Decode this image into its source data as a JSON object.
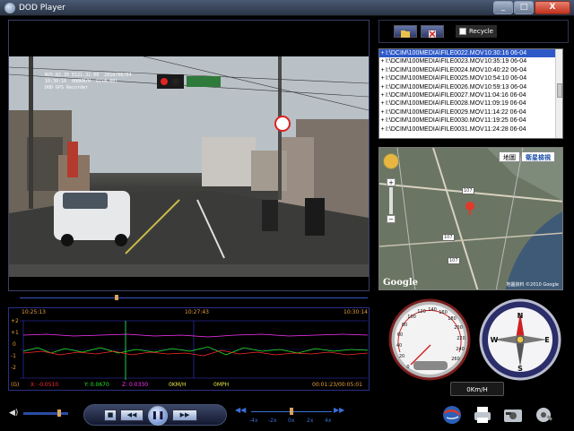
{
  "window": {
    "title": "DOD Player",
    "buttons": [
      "_",
      "□",
      "X"
    ]
  },
  "video": {
    "osd_lines": [
      "N25.02.35 E121.32.00  2010/06/04",
      "10:30:16  000KM/H  G(+0.00)",
      "DOD GPS Recorder"
    ]
  },
  "gsensor": {
    "time_start": "10:25:13",
    "time_mid": "10:27:43",
    "time_end": "10:30:14",
    "y_labels": [
      "+2",
      "+1",
      "0",
      "-1",
      "-2"
    ],
    "unit_label": "(G)",
    "x_value": "X: -0.0510",
    "y_value": "Y: 0.0670",
    "z_value": "Z: 0.0330",
    "kmh": "0KM/H",
    "mph": "0MPH",
    "elapsed": "00:01:23/00:05:01",
    "colors": {
      "x": "#ff2a2a",
      "y": "#22ee22",
      "z": "#ff33ff",
      "time": "#e6a23c"
    }
  },
  "playlist": {
    "recycle_label": "Recycle",
    "files": [
      {
        "name": "I:\\DCIM\\100MEDIA\\FILE0022.MOV",
        "time": "10:30:16 06-04",
        "selected": true
      },
      {
        "name": "I:\\DCIM\\100MEDIA\\FILE0023.MOV",
        "time": "10:35:19 06-04",
        "selected": false
      },
      {
        "name": "I:\\DCIM\\100MEDIA\\FILE0024.MOV",
        "time": "10:40:22 06-04",
        "selected": false
      },
      {
        "name": "I:\\DCIM\\100MEDIA\\FILE0025.MOV",
        "time": "10:54:10 06-04",
        "selected": false
      },
      {
        "name": "I:\\DCIM\\100MEDIA\\FILE0026.MOV",
        "time": "10:59:13 06-04",
        "selected": false
      },
      {
        "name": "I:\\DCIM\\100MEDIA\\FILE0027.MOV",
        "time": "11:04:16 06-04",
        "selected": false
      },
      {
        "name": "I:\\DCIM\\100MEDIA\\FILE0028.MOV",
        "time": "11:09:19 06-04",
        "selected": false
      },
      {
        "name": "I:\\DCIM\\100MEDIA\\FILE0029.MOV",
        "time": "11:14:22 06-04",
        "selected": false
      },
      {
        "name": "I:\\DCIM\\100MEDIA\\FILE0030.MOV",
        "time": "11:19:25 06-04",
        "selected": false
      },
      {
        "name": "I:\\DCIM\\100MEDIA\\FILE0031.MOV",
        "time": "11:24:28 06-04",
        "selected": false
      }
    ]
  },
  "map": {
    "btn_map": "地圖",
    "btn_satellite": "衛星檢視",
    "road_labels": [
      "107",
      "107",
      "107"
    ],
    "footer": "地圖資料 ©2010 Google",
    "google_logo": "Google"
  },
  "gauges": {
    "speedometer_ticks": [
      "0",
      "20",
      "40",
      "60",
      "80",
      "100",
      "120",
      "140",
      "160",
      "180",
      "200",
      "220",
      "240",
      "260"
    ],
    "speed_value_kmh": 0,
    "compass_labels": [
      "N",
      "E",
      "S",
      "W"
    ],
    "speed_readout": "0Km/H"
  },
  "player": {
    "stop_symbol": "■",
    "rewind_symbol": "◀◀",
    "play_symbol": "❚❚",
    "forward_symbol": "▶▶",
    "speed_ticks": [
      "-4x",
      "-2x",
      "0x",
      "2x",
      "4x"
    ]
  }
}
